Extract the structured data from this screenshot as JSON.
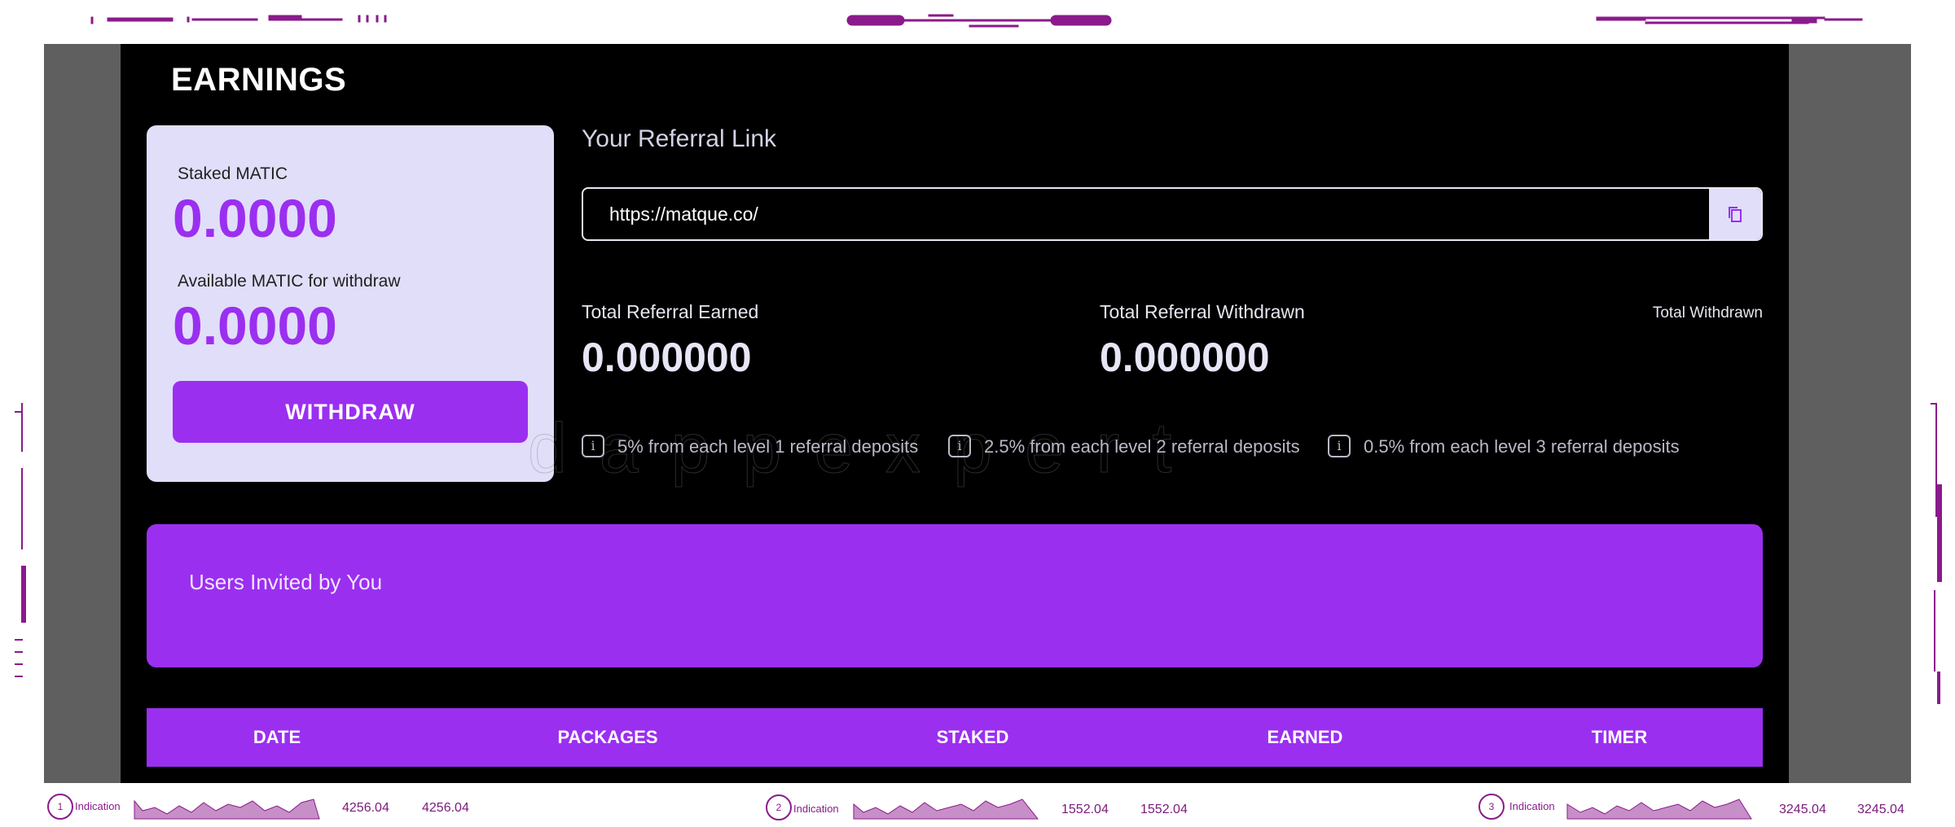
{
  "page": {
    "title": "EARNINGS"
  },
  "stake_card": {
    "staked_label": "Staked MATIC",
    "staked_value": "0.0000",
    "available_label": "Available MATIC for withdraw",
    "available_value": "0.0000",
    "withdraw_button": "WITHDRAW"
  },
  "referral": {
    "title": "Your Referral Link",
    "link": "https://matque.co/",
    "copy_icon": "copy-icon",
    "total_earned_label": "Total Referral Earned",
    "total_earned_value": "0.000000",
    "total_withdrawn_label": "Total Referral Withdrawn",
    "total_withdrawn_value": "0.000000",
    "total_withdrawn_small": "Total Withdrawn",
    "levels": [
      {
        "text": "5% from each level 1 referral deposits"
      },
      {
        "text": "2.5% from each level 2 referral deposits"
      },
      {
        "text": "0.5% from each level 3 referral deposits"
      }
    ],
    "info_icon_glyph": "i"
  },
  "watermark": "dappexpert",
  "invited": {
    "title": "Users Invited by You"
  },
  "table": {
    "headers": [
      "DATE",
      "PACKAGES",
      "STAKED",
      "EARNED",
      "TIMER"
    ]
  },
  "indicators": [
    {
      "index": "1",
      "label": "Indication",
      "value_a": "4256.04",
      "value_b": "4256.04"
    },
    {
      "index": "2",
      "label": "Indication",
      "value_a": "1552.04",
      "value_b": "1552.04"
    },
    {
      "index": "3",
      "label": "Indication",
      "value_a": "3245.04",
      "value_b": "3245.04"
    }
  ],
  "colors": {
    "accent": "#9b2ff0",
    "card_bg": "#e1def9",
    "app_bg": "#000000",
    "frame_bg": "#5f5f5f",
    "deco": "#8b1a8b"
  }
}
